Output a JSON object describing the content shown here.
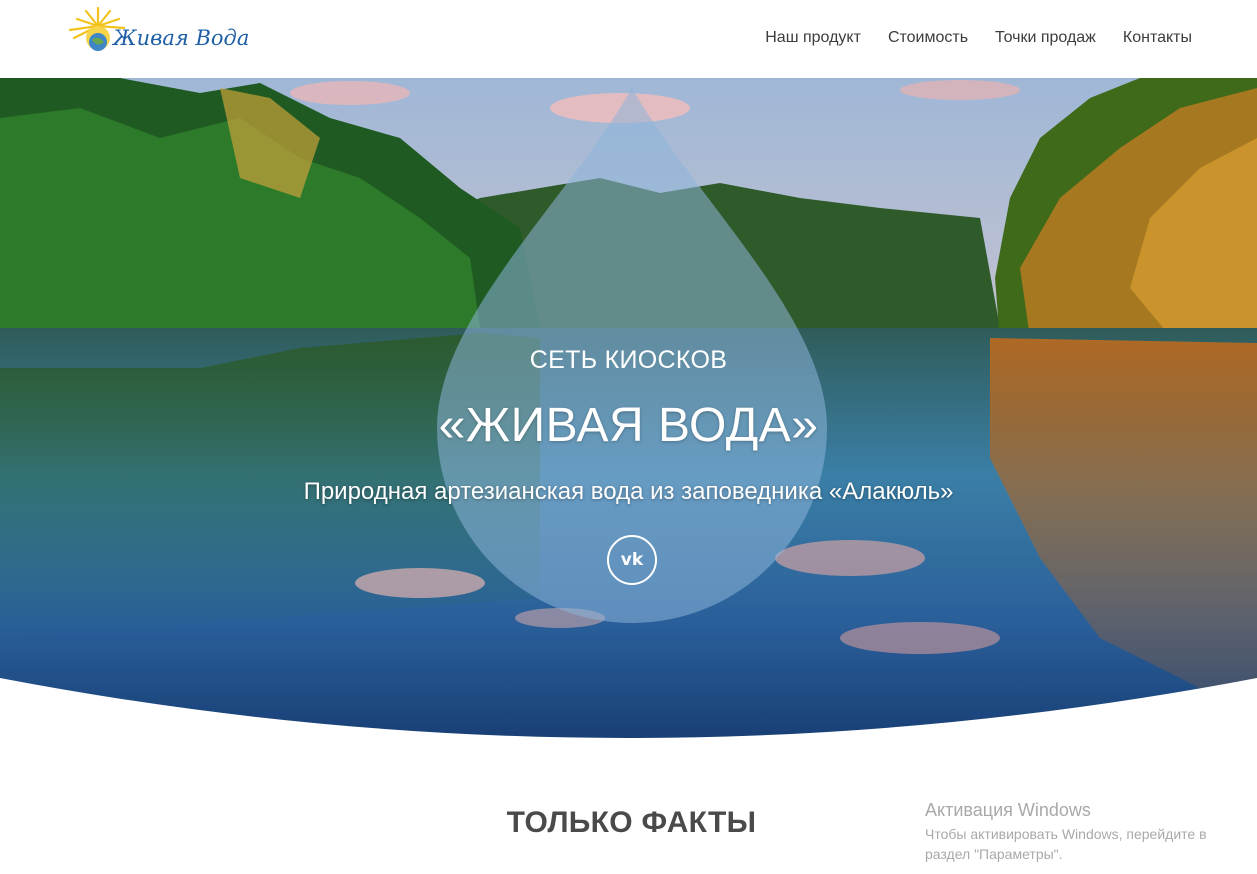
{
  "header": {
    "logo_text": "Живая Вода",
    "nav": [
      {
        "label": "Наш продукт"
      },
      {
        "label": "Стоимость"
      },
      {
        "label": "Точки продаж"
      },
      {
        "label": "Контакты"
      }
    ]
  },
  "hero": {
    "subtitle_top": "СЕТЬ КИОСКОВ",
    "title": "«ЖИВАЯ ВОДА»",
    "tagline": "Природная артезианская вода из заповедника «Алакюль»",
    "vk_icon": "vk-icon",
    "vk_label": "vk"
  },
  "facts": {
    "title": "ТОЛЬКО ФАКТЫ"
  },
  "windows_watermark": {
    "title": "Активация Windows",
    "text": "Чтобы активировать Windows, перейдите в раздел \"Параметры\"."
  },
  "colors": {
    "brand_blue": "#1f5fa6",
    "sun_yellow": "#f4c21c",
    "nav_text": "#3d3d3d",
    "heading_text": "#4a4a4a"
  }
}
